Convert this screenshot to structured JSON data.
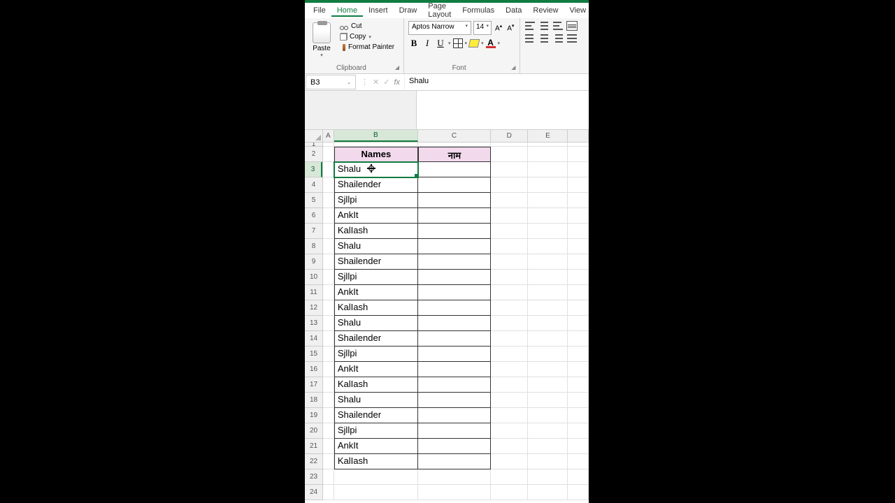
{
  "menu": {
    "items": [
      "File",
      "Home",
      "Insert",
      "Draw",
      "Page Layout",
      "Formulas",
      "Data",
      "Review",
      "View"
    ],
    "active": "Home"
  },
  "ribbon": {
    "clipboard": {
      "paste": "Paste",
      "cut": "Cut",
      "copy": "Copy",
      "format_painter": "Format Painter",
      "group_label": "Clipboard"
    },
    "font": {
      "name": "Aptos Narrow",
      "size": "14",
      "group_label": "Font"
    }
  },
  "formula_bar": {
    "cell_ref": "B3",
    "value": "Shalu"
  },
  "grid": {
    "columns": [
      "A",
      "B",
      "C",
      "D",
      "E"
    ],
    "headers": {
      "B": "Names",
      "C": "नाम"
    },
    "rows": [
      {
        "n": 3,
        "b": "Shalu"
      },
      {
        "n": 4,
        "b": "Shailender"
      },
      {
        "n": 5,
        "b": "Sjllpi"
      },
      {
        "n": 6,
        "b": "AnkIt"
      },
      {
        "n": 7,
        "b": "KalIash"
      },
      {
        "n": 8,
        "b": "Shalu"
      },
      {
        "n": 9,
        "b": "Shailender"
      },
      {
        "n": 10,
        "b": "Sjllpi"
      },
      {
        "n": 11,
        "b": "AnkIt"
      },
      {
        "n": 12,
        "b": "KalIash"
      },
      {
        "n": 13,
        "b": "Shalu"
      },
      {
        "n": 14,
        "b": "Shailender"
      },
      {
        "n": 15,
        "b": "Sjllpi"
      },
      {
        "n": 16,
        "b": "AnkIt"
      },
      {
        "n": 17,
        "b": "KalIash"
      },
      {
        "n": 18,
        "b": "Shalu"
      },
      {
        "n": 19,
        "b": "Shailender"
      },
      {
        "n": 20,
        "b": "Sjllpi"
      },
      {
        "n": 21,
        "b": "AnkIt"
      },
      {
        "n": 22,
        "b": "KalIash"
      }
    ],
    "empty_rows": [
      23,
      24
    ]
  },
  "chart_data": {
    "type": "table",
    "columns": [
      "Names",
      "नाम"
    ],
    "rows": [
      [
        "Shalu",
        ""
      ],
      [
        "Shailender",
        ""
      ],
      [
        "Sjllpi",
        ""
      ],
      [
        "AnkIt",
        ""
      ],
      [
        "KalIash",
        ""
      ],
      [
        "Shalu",
        ""
      ],
      [
        "Shailender",
        ""
      ],
      [
        "Sjllpi",
        ""
      ],
      [
        "AnkIt",
        ""
      ],
      [
        "KalIash",
        ""
      ],
      [
        "Shalu",
        ""
      ],
      [
        "Shailender",
        ""
      ],
      [
        "Sjllpi",
        ""
      ],
      [
        "AnkIt",
        ""
      ],
      [
        "KalIash",
        ""
      ],
      [
        "Shalu",
        ""
      ],
      [
        "Shailender",
        ""
      ],
      [
        "Sjllpi",
        ""
      ],
      [
        "AnkIt",
        ""
      ],
      [
        "KalIash",
        ""
      ]
    ]
  }
}
